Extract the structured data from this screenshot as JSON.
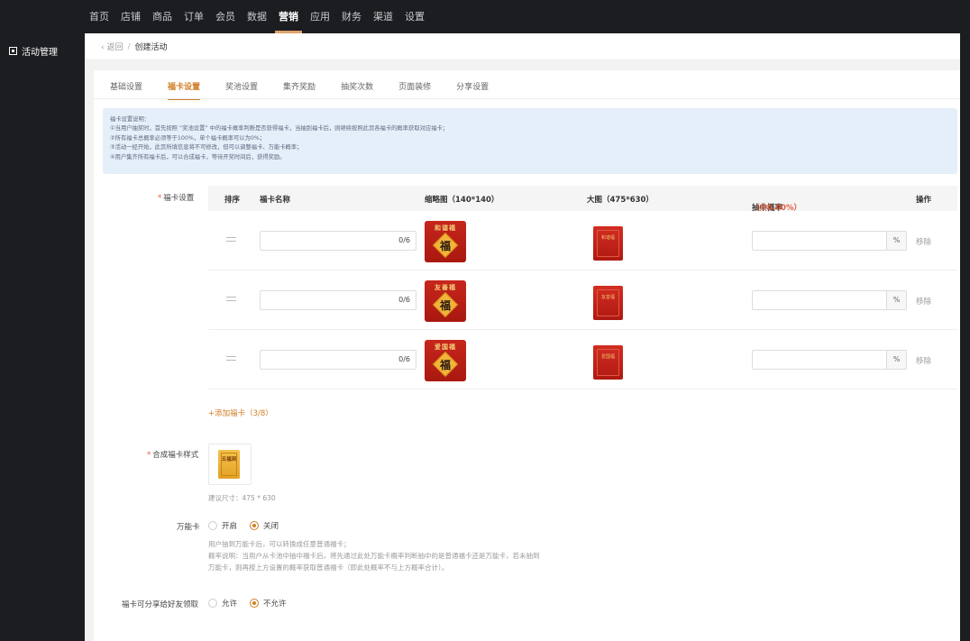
{
  "topnav": {
    "items": [
      "首页",
      "店铺",
      "商品",
      "订单",
      "会员",
      "数据",
      "营销",
      "应用",
      "财务",
      "渠道",
      "设置"
    ],
    "active": "营销"
  },
  "sidebar": {
    "item": "活动管理"
  },
  "breadcrumb": {
    "back": "返回",
    "sep": "/",
    "current": "创建活动"
  },
  "tabs": [
    "基础设置",
    "福卡设置",
    "奖池设置",
    "集齐奖励",
    "抽奖次数",
    "页面装修",
    "分享设置"
  ],
  "notice": {
    "lines": [
      "福卡设置说明：",
      "①当用户抽奖时，首先按照 “奖池设置” 中的福卡概率判断是否获得福卡，当抽到福卡后，则继续按照此页各福卡的概率获取对应福卡；",
      "②所有福卡总概率必须等于100%，单个福卡概率可以为0%；",
      "③活动一经开始，此页所填信息将不可修改，但可以调整福卡、万能卡概率；",
      "④用户集齐所有福卡后，可以合成福卡，等待开奖时间后，获得奖励。"
    ]
  },
  "form": {
    "card_settings_label": "福卡设置",
    "composite_label": "合成福卡样式",
    "universal_label": "万能卡",
    "share_label": "福卡可分享给好友领取",
    "required_mark": "*"
  },
  "table": {
    "headers": {
      "sort": "排序",
      "name": "福卡名称",
      "thumb": "缩略图（140*140）",
      "big": "大图（475*630）",
      "prob": "抽中概率",
      "prob_total": "（共0.00%）",
      "action": "操作"
    },
    "rows": [
      {
        "count": "0/6",
        "thumb_title": "和谐福",
        "fu": "福",
        "big_text": "和谐福",
        "suffix": "%",
        "remove": "移除"
      },
      {
        "count": "0/6",
        "thumb_title": "友善福",
        "fu": "福",
        "big_text": "友善福",
        "suffix": "%",
        "remove": "移除"
      },
      {
        "count": "0/6",
        "thumb_title": "爱国福",
        "fu": "福",
        "big_text": "爱国福",
        "suffix": "%",
        "remove": "移除"
      }
    ],
    "add_card": "+添加福卡（3/8）"
  },
  "composite": {
    "text": "五福到",
    "hint": "建议尺寸：475 * 630"
  },
  "universal": {
    "options": [
      "开启",
      "关闭"
    ],
    "selected": 1,
    "desc": [
      "用户抽到万能卡后，可以转换成任意普通福卡；",
      "概率说明：当用户从卡池中抽中福卡后，将先通过此处万能卡概率判断抽中的是普通福卡还是万能卡，若未抽到",
      "万能卡，则再按上方设置的概率获取普通福卡（即此处概率不与上方概率合计）。"
    ]
  },
  "share": {
    "options": [
      "允许",
      "不允许"
    ],
    "selected": 1
  },
  "colors": {
    "accent": "#d07e26",
    "dark": "#1c1d21",
    "notice_bg": "#e4effa",
    "required": "#e05c3c"
  }
}
